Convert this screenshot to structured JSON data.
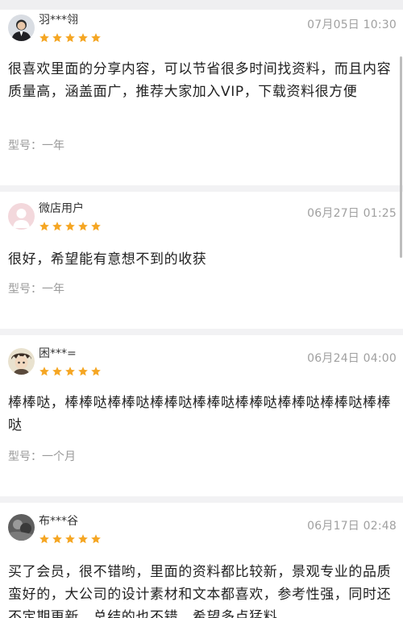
{
  "reviews": [
    {
      "username": "羽***翎",
      "avatar_icon": "user-avatar-man-suit",
      "rating": 5,
      "date": "07月05日 10:30",
      "content": "很喜欢里面的分享内容，可以节省很多时间找资料，而且内容质量高，涵盖面广，推荐大家加入VIP，下载资料很方便",
      "model": "型号：一年"
    },
    {
      "username": "微店用户",
      "avatar_icon": "default-user-avatar",
      "rating": 5,
      "date": "06月27日 01:25",
      "content": "很好，希望能有意想不到的收获",
      "model": "型号：一年"
    },
    {
      "username": "困***=",
      "avatar_icon": "anime-avatar",
      "rating": 5,
      "date": "06月24日 04:00",
      "content": "棒棒哒，棒棒哒棒棒哒棒棒哒棒棒哒棒棒哒棒棒哒棒棒哒棒棒哒",
      "model": "型号：一个月"
    },
    {
      "username": "布***谷",
      "avatar_icon": "photo-avatar",
      "rating": 5,
      "date": "06月17日 02:48",
      "content": "买了会员，很不错哟，里面的资料都比较新，景观专业的品质蛮好的，大公司的设计素材和文本都喜欢，参考性强，同时还不定期更新，总结的也不错，希望多点猛料",
      "model": ""
    }
  ],
  "colors": {
    "star": "#f5a623",
    "date": "#a0a0a0",
    "model": "#9a9a9a",
    "separator": "#f2f2f4"
  }
}
